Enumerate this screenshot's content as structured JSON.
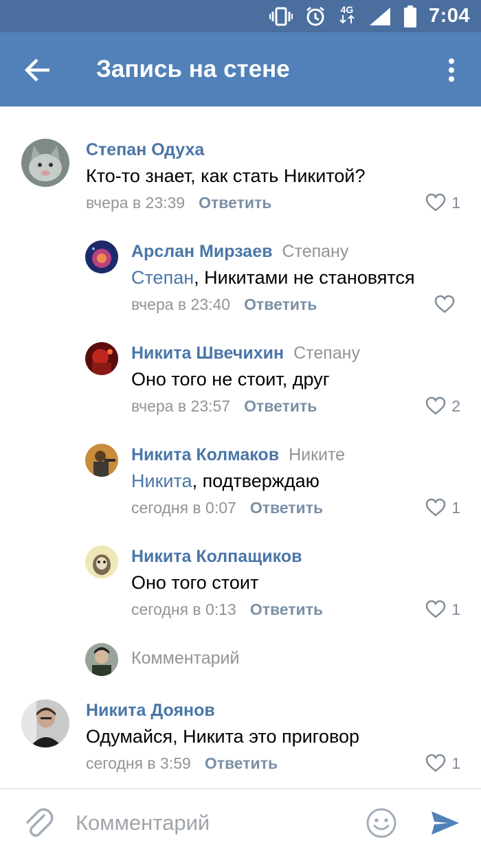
{
  "status_bar": {
    "time": "7:04",
    "network": "4G",
    "icons": [
      "vibrate-icon",
      "alarm-icon",
      "network-4g-icon",
      "signal-icon",
      "battery-icon"
    ]
  },
  "app_bar": {
    "title": "Запись на стене",
    "back_icon": "arrow-left-icon",
    "menu_icon": "more-vertical-icon"
  },
  "comments": [
    {
      "author": "Степан Одуха",
      "reply_to": "",
      "mention": "",
      "text": "Кто-то знает, как стать Никитой?",
      "time": "вчера в 23:39",
      "reply_label": "Ответить",
      "likes": "1"
    },
    {
      "author": "Арслан Мирзаев",
      "reply_to": "Степану",
      "mention": "Степан",
      "text": ", Никитами не становятся",
      "time": "вчера в 23:40",
      "reply_label": "Ответить",
      "likes": ""
    },
    {
      "author": "Никита Швечихин",
      "reply_to": "Степану",
      "mention": "",
      "text": "Оно того не стоит, друг",
      "time": "вчера в 23:57",
      "reply_label": "Ответить",
      "likes": "2"
    },
    {
      "author": "Никита Колмаков",
      "reply_to": "Никите",
      "mention": "Никита",
      "text": ", подтверждаю",
      "time": "сегодня в 0:07",
      "reply_label": "Ответить",
      "likes": "1"
    },
    {
      "author": "Никита Колпащиков",
      "reply_to": "",
      "mention": "",
      "text": "Оно того стоит",
      "time": "сегодня в 0:13",
      "reply_label": "Ответить",
      "likes": "1"
    },
    {
      "author": "Никита Доянов",
      "reply_to": "",
      "mention": "",
      "text": "Одумайся, Никита это приговор",
      "time": "сегодня в 3:59",
      "reply_label": "Ответить",
      "likes": "1"
    }
  ],
  "thread_reply": {
    "placeholder": "Комментарий"
  },
  "bottom_bar": {
    "placeholder": "Комментарий",
    "attach_icon": "paperclip-icon",
    "emoji_icon": "smiley-icon",
    "send_icon": "send-icon"
  },
  "colors": {
    "status_bar": "#4a6f9f",
    "app_bar": "#5181b8",
    "link_blue": "#4a76a8",
    "meta_gray": "#939393",
    "send_blue": "#5181b8"
  }
}
